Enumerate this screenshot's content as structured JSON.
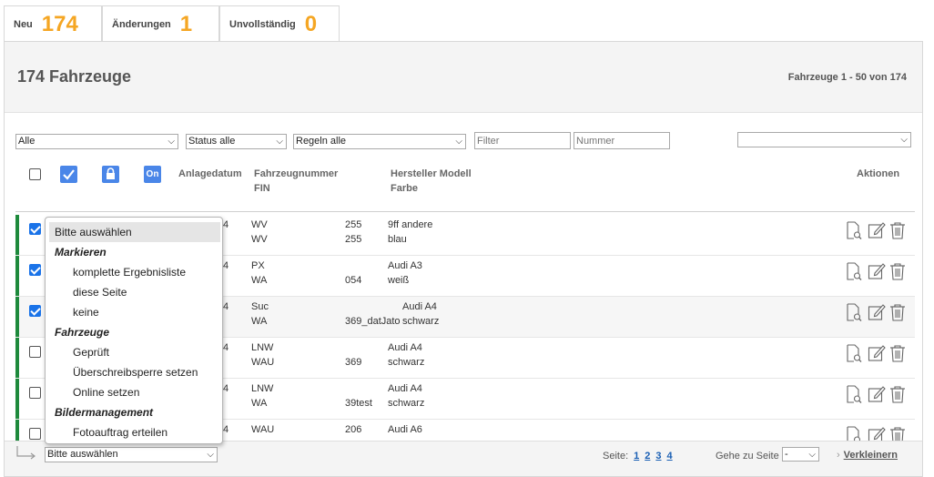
{
  "counters": [
    {
      "label": "Neu",
      "value": "174"
    },
    {
      "label": "Änderungen",
      "value": "1"
    },
    {
      "label": "Unvollständig",
      "value": "0"
    }
  ],
  "header": {
    "title": "174 Fahrzeuge",
    "range": "Fahrzeuge 1 - 50 von 174"
  },
  "filters": {
    "type_select": "Alle",
    "status_select": "Status alle",
    "rules_select": "Regeln alle",
    "filter_placeholder": "Filter",
    "number_placeholder": "Nummer",
    "right_select": ""
  },
  "columns": {
    "created": "Anlagedatum",
    "vehicle_number": "Fahrzeugnummer",
    "fin": "FIN",
    "make_model": "Hersteller Modell",
    "color": "Farbe",
    "actions": "Aktionen",
    "online_badge": "On"
  },
  "rows": [
    {
      "checked": true,
      "date_tail": "4",
      "num1": "WV",
      "num1_tail": "255",
      "num2": "WV",
      "num2_tail": "255",
      "model": "9ff andere",
      "color": "blau"
    },
    {
      "checked": true,
      "date_tail": "4",
      "num1": "PX",
      "num1_tail": "",
      "num2": "WA",
      "num2_tail": "054",
      "model": "Audi A3",
      "color": "weiß"
    },
    {
      "checked": true,
      "date_tail": "4",
      "num1": "Suc",
      "num1_tail": "",
      "num2": "WA",
      "num2_tail": "369_datJato",
      "model": "Audi A4",
      "color": "schwarz"
    },
    {
      "checked": false,
      "date_tail": "4",
      "num1": "LNW",
      "num1_tail": "",
      "num2": "WAU",
      "num2_tail": "369",
      "model": "Audi A4",
      "color": "schwarz"
    },
    {
      "checked": false,
      "date_tail": "4",
      "num1": "LNW",
      "num1_tail": "",
      "num2": "WA",
      "num2_tail": "39test",
      "model": "Audi A4",
      "color": "schwarz"
    },
    {
      "checked": false,
      "date_tail": "4",
      "num1": "WAU",
      "num1_tail": "206",
      "num2": "",
      "num2_tail": "",
      "model": "Audi A6",
      "color": ""
    }
  ],
  "bulk_dropdown": {
    "selected": "Bitte auswählen",
    "group_mark": "Markieren",
    "mark_all": "komplette Ergebnisliste",
    "mark_page": "diese Seite",
    "mark_none": "keine",
    "group_vehicles": "Fahrzeuge",
    "checked": "Geprüft",
    "overwrite_lock": "Überschreibsperre setzen",
    "set_online": "Online setzen",
    "group_images": "Bildermanagement",
    "photo_order": "Fotoauftrag erteilen"
  },
  "footer": {
    "bulk_select": "Bitte auswählen",
    "page_label": "Seite:",
    "pages": [
      "1",
      "2",
      "3",
      "4"
    ],
    "goto_label": "Gehe zu Seite",
    "goto_value": "-",
    "collapse": "Verkleinern"
  },
  "colors": {
    "accent_orange": "#f5a623",
    "status_green": "#1e8a3c",
    "checkbox_blue": "#1a73e8"
  }
}
